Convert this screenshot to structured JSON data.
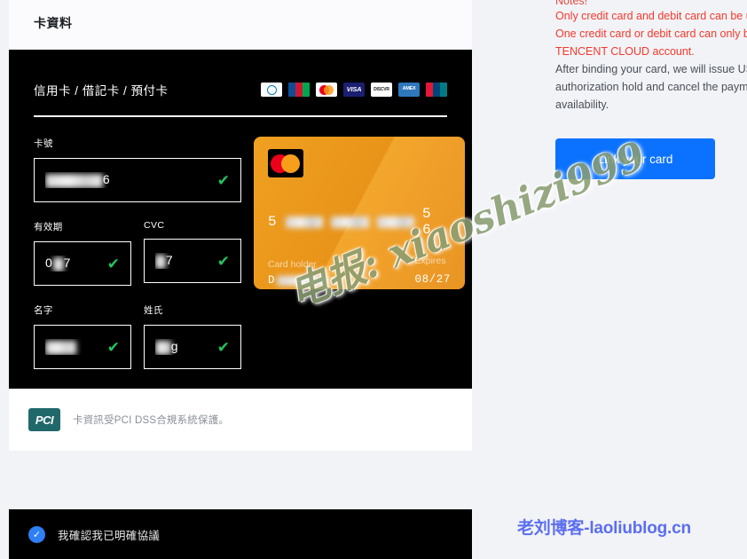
{
  "page": {
    "section_title": "卡資料"
  },
  "form": {
    "card_type_label": "信用卡 / 借記卡 / 預付卡",
    "payment_logos": [
      {
        "name": "diners-club-logo",
        "text": "Diners Club"
      },
      {
        "name": "jcb-logo",
        "text": "JCB"
      },
      {
        "name": "mastercard-logo",
        "text": "Mastercard"
      },
      {
        "name": "visa-logo",
        "text": "VISA"
      },
      {
        "name": "discover-logo",
        "text": "DISCOVER"
      },
      {
        "name": "amex-logo",
        "text": "AMEX"
      },
      {
        "name": "unionpay-logo",
        "text": "UnionPay"
      }
    ],
    "fields": {
      "card_number": {
        "label": "卡號",
        "value_prefix": "",
        "value_masked": "•••••••••••",
        "value_suffix": "6",
        "validated": true,
        "check_glyph": "✔"
      },
      "expiry": {
        "label": "有效期",
        "value_prefix": "0",
        "value_masked": "••",
        "value_suffix": "7",
        "validated": true,
        "check_glyph": "✔"
      },
      "cvc": {
        "label": "CVC",
        "value_prefix": "",
        "value_masked": "••",
        "value_suffix": "7",
        "validated": true,
        "check_glyph": "✔"
      },
      "first_name": {
        "label": "名字",
        "value_prefix": "",
        "value_masked": "••••••",
        "value_suffix": "",
        "validated": true,
        "check_glyph": "✔"
      },
      "last_name": {
        "label": "姓氏",
        "value_prefix": "",
        "value_masked": "•••",
        "value_suffix": "g",
        "validated": true,
        "check_glyph": "✔"
      }
    }
  },
  "card_preview": {
    "brand": "mastercard",
    "number_first": "5",
    "number_last": "5 6",
    "holder_caption": "Card holder",
    "holder_prefix": "D",
    "holder_suffix": "g",
    "expires_caption": "Expires",
    "expires_value": "08/27",
    "background_color": "#e8941a"
  },
  "pci": {
    "badge_text": "PCI",
    "text": "卡資訊受PCI DSS合規系統保護。"
  },
  "consent": {
    "checked": true,
    "check_glyph": "✓",
    "text": "我確認我已明確協議"
  },
  "notes": {
    "title": "Notes!",
    "lines": [
      {
        "text": "Only credit card and debit card can be us",
        "color": "red"
      },
      {
        "text": "One credit card or debit card can only be",
        "color": "red"
      },
      {
        "text": "TENCENT CLOUD account.",
        "color": "red"
      },
      {
        "text": "After binding your card, we will issue US",
        "color": "gray"
      },
      {
        "text": "authorization hold and cancel the payme",
        "color": "gray"
      },
      {
        "text": "availability.",
        "color": "gray"
      }
    ],
    "link_button_label": "Link your card"
  },
  "watermarks": {
    "main": "电报: xiaoshizi999",
    "bottom": "老刘博客-laoliublog.cn"
  },
  "colors": {
    "accent_blue": "#0b72ff",
    "note_red": "#f5392c",
    "check_green": "#22c55e",
    "card_orange": "#e8941a",
    "watermark_green": "#8a9e72",
    "watermark_blue": "#5b6ef0"
  }
}
